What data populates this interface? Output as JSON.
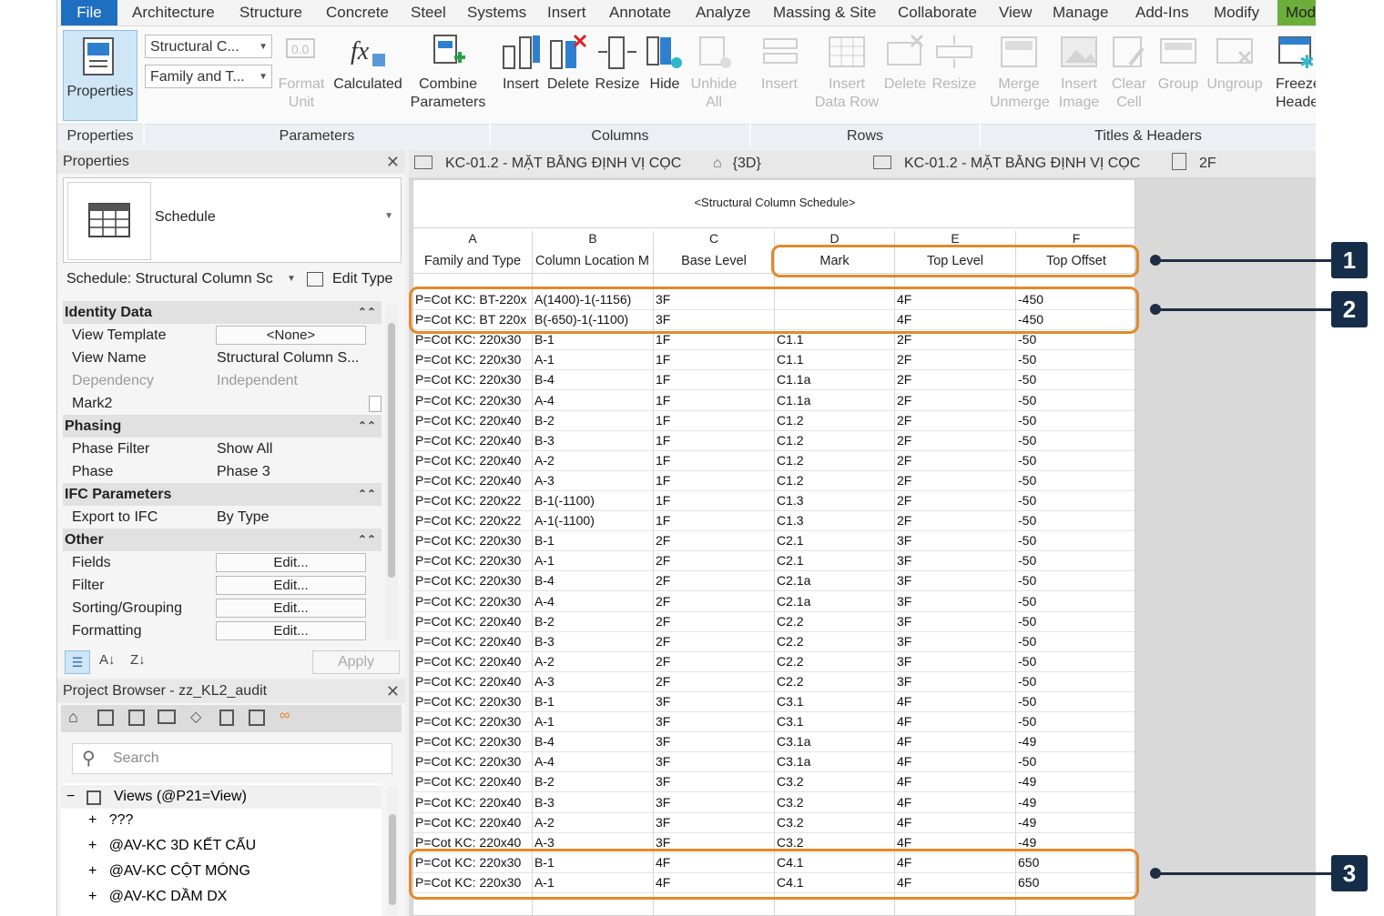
{
  "menu": {
    "file": "File",
    "items": [
      "Architecture",
      "Structure",
      "Concrete",
      "Steel",
      "Systems",
      "Insert",
      "Annotate",
      "Analyze",
      "Massing & Site",
      "Collaborate",
      "View",
      "Manage",
      "Add-Ins",
      "Modify",
      "Mod"
    ]
  },
  "ribbon": {
    "properties": "Properties",
    "combo_category": "Structural C...",
    "combo_family": "Family and T...",
    "format_unit": "Format\nUnit",
    "format_unit_l1": "Format",
    "format_unit_l2": "Unit",
    "calculated": "Calculated",
    "combine_l1": "Combine",
    "combine_l2": "Parameters",
    "insert": "Insert",
    "delete": "Delete",
    "resize": "Resize",
    "hide": "Hide",
    "unhide_l1": "Unhide",
    "unhide_l2": "All",
    "rows_insert": "Insert",
    "insert_data_l1": "Insert",
    "insert_data_l2": "Data Row",
    "rows_delete": "Delete",
    "rows_resize": "Resize",
    "merge_l1": "Merge",
    "merge_l2": "Unmerge",
    "image_l1": "Insert",
    "image_l2": "Image",
    "clear_l1": "Clear",
    "clear_l2": "Cell",
    "group": "Group",
    "ungroup": "Ungroup",
    "freeze_l1": "Freeze",
    "freeze_l2": "Heade",
    "panels": {
      "properties": "Properties",
      "parameters": "Parameters",
      "columns": "Columns",
      "rows": "Rows",
      "titles": "Titles & Headers"
    }
  },
  "properties_panel": {
    "title": "Properties",
    "type_name": "Schedule",
    "instance_selector": "Schedule: Structural Column Sc",
    "edit_type": "Edit Type",
    "apply": "Apply",
    "sections": {
      "identity": "Identity Data",
      "phasing": "Phasing",
      "ifc": "IFC Parameters",
      "other": "Other"
    },
    "rows": {
      "view_template": {
        "label": "View Template",
        "value": "<None>"
      },
      "view_name": {
        "label": "View Name",
        "value": "Structural Column S..."
      },
      "dependency": {
        "label": "Dependency",
        "value": "Independent"
      },
      "mark2": {
        "label": "Mark2",
        "value": ""
      },
      "phase_filter": {
        "label": "Phase Filter",
        "value": "Show All"
      },
      "phase": {
        "label": "Phase",
        "value": "Phase 3"
      },
      "export_ifc": {
        "label": "Export to IFC",
        "value": "By Type"
      },
      "fields": {
        "label": "Fields",
        "value": "Edit..."
      },
      "filter": {
        "label": "Filter",
        "value": "Edit..."
      },
      "sorting": {
        "label": "Sorting/Grouping",
        "value": "Edit..."
      },
      "formatting": {
        "label": "Formatting",
        "value": "Edit..."
      }
    }
  },
  "project_browser": {
    "title": "Project Browser - zz_KL2_audit",
    "search_placeholder": "Search",
    "root": "Views (@P21=View)",
    "items": [
      "???",
      "@AV-KC 3D KẾT CẤU",
      "@AV-KC CỘT MÓNG",
      "@AV-KC DẦM DX"
    ]
  },
  "view_tabs": [
    "KC-01.2 - MẶT BẰNG ĐỊNH VỊ CỌC",
    "{3D}",
    "KC-01.2 - MẶT BẰNG ĐỊNH VỊ CỌC",
    "2F"
  ],
  "schedule": {
    "title": "<Structural Column Schedule>",
    "column_letters": [
      "A",
      "B",
      "C",
      "D",
      "E",
      "F"
    ],
    "field_headers": [
      "Family and Type",
      "Column Location M",
      "Base Level",
      "Mark",
      "Top Level",
      "Top Offset"
    ],
    "rows": [
      [
        "P=Cot KC: BT-220x",
        "A(1400)-1(-1156)",
        "3F",
        "",
        "4F",
        "-450"
      ],
      [
        "P=Cot KC: BT 220x",
        "B(-650)-1(-1100)",
        "3F",
        "",
        "4F",
        "-450"
      ],
      [
        "P=Cot KC: 220x30",
        "B-1",
        "1F",
        "C1.1",
        "2F",
        "-50"
      ],
      [
        "P=Cot KC: 220x30",
        "A-1",
        "1F",
        "C1.1",
        "2F",
        "-50"
      ],
      [
        "P=Cot KC: 220x30",
        "B-4",
        "1F",
        "C1.1a",
        "2F",
        "-50"
      ],
      [
        "P=Cot KC: 220x30",
        "A-4",
        "1F",
        "C1.1a",
        "2F",
        "-50"
      ],
      [
        "P=Cot KC: 220x40",
        "B-2",
        "1F",
        "C1.2",
        "2F",
        "-50"
      ],
      [
        "P=Cot KC: 220x40",
        "B-3",
        "1F",
        "C1.2",
        "2F",
        "-50"
      ],
      [
        "P=Cot KC: 220x40",
        "A-2",
        "1F",
        "C1.2",
        "2F",
        "-50"
      ],
      [
        "P=Cot KC: 220x40",
        "A-3",
        "1F",
        "C1.2",
        "2F",
        "-50"
      ],
      [
        "P=Cot KC: 220x22",
        "B-1(-1100)",
        "1F",
        "C1.3",
        "2F",
        "-50"
      ],
      [
        "P=Cot KC: 220x22",
        "A-1(-1100)",
        "1F",
        "C1.3",
        "2F",
        "-50"
      ],
      [
        "P=Cot KC: 220x30",
        "B-1",
        "2F",
        "C2.1",
        "3F",
        "-50"
      ],
      [
        "P=Cot KC: 220x30",
        "A-1",
        "2F",
        "C2.1",
        "3F",
        "-50"
      ],
      [
        "P=Cot KC: 220x30",
        "B-4",
        "2F",
        "C2.1a",
        "3F",
        "-50"
      ],
      [
        "P=Cot KC: 220x30",
        "A-4",
        "2F",
        "C2.1a",
        "3F",
        "-50"
      ],
      [
        "P=Cot KC: 220x40",
        "B-2",
        "2F",
        "C2.2",
        "3F",
        "-50"
      ],
      [
        "P=Cot KC: 220x40",
        "B-3",
        "2F",
        "C2.2",
        "3F",
        "-50"
      ],
      [
        "P=Cot KC: 220x40",
        "A-2",
        "2F",
        "C2.2",
        "3F",
        "-50"
      ],
      [
        "P=Cot KC: 220x40",
        "A-3",
        "2F",
        "C2.2",
        "3F",
        "-50"
      ],
      [
        "P=Cot KC: 220x30",
        "B-1",
        "3F",
        "C3.1",
        "4F",
        "-50"
      ],
      [
        "P=Cot KC: 220x30",
        "A-1",
        "3F",
        "C3.1",
        "4F",
        "-50"
      ],
      [
        "P=Cot KC: 220x30",
        "B-4",
        "3F",
        "C3.1a",
        "4F",
        "-49"
      ],
      [
        "P=Cot KC: 220x30",
        "A-4",
        "3F",
        "C3.1a",
        "4F",
        "-50"
      ],
      [
        "P=Cot KC: 220x40",
        "B-2",
        "3F",
        "C3.2",
        "4F",
        "-49"
      ],
      [
        "P=Cot KC: 220x40",
        "B-3",
        "3F",
        "C3.2",
        "4F",
        "-49"
      ],
      [
        "P=Cot KC: 220x40",
        "A-2",
        "3F",
        "C3.2",
        "4F",
        "-49"
      ],
      [
        "P=Cot KC: 220x40",
        "A-3",
        "3F",
        "C3.2",
        "4F",
        "-49"
      ],
      [
        "P=Cot KC: 220x30",
        "B-1",
        "4F",
        "C4.1",
        "4F",
        "650"
      ],
      [
        "P=Cot KC: 220x30",
        "A-1",
        "4F",
        "C4.1",
        "4F",
        "650"
      ]
    ]
  },
  "callouts": [
    "1",
    "2",
    "3"
  ],
  "colors": {
    "callout_border": "#e08a2c",
    "badge": "#162d4a",
    "file_tab": "#1e6fc0",
    "modify_tab": "#6cae3a"
  }
}
